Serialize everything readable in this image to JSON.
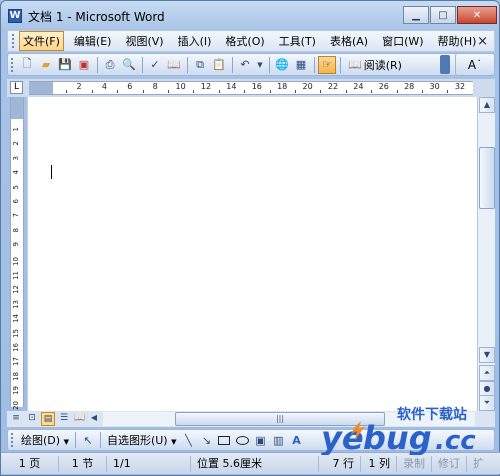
{
  "window": {
    "title": "文档 1 - Microsoft Word",
    "app_icon": "W",
    "minimize_icon": "minimize-icon",
    "maximize_icon": "maximize-icon",
    "close_icon": "close-icon"
  },
  "menu": {
    "items": [
      {
        "label": "文件(F)",
        "active": true
      },
      {
        "label": "编辑(E)"
      },
      {
        "label": "视图(V)"
      },
      {
        "label": "插入(I)"
      },
      {
        "label": "格式(O)"
      },
      {
        "label": "工具(T)"
      },
      {
        "label": "表格(A)"
      },
      {
        "label": "窗口(W)"
      },
      {
        "label": "帮助(H)"
      }
    ],
    "close_glyph": "×"
  },
  "toolbar": {
    "reading_label": "阅读(R)",
    "font_size_glyph": "A˙"
  },
  "ruler": {
    "corner": "L",
    "h_ticks": [
      "2",
      "4",
      "6",
      "8",
      "10",
      "12",
      "14",
      "16",
      "18",
      "20",
      "22",
      "24",
      "26",
      "28",
      "30",
      "32"
    ],
    "v_ticks": [
      "1",
      "2",
      "3",
      "4",
      "5",
      "6",
      "7",
      "8",
      "9",
      "10",
      "11",
      "12",
      "13",
      "14",
      "15",
      "16",
      "17",
      "18",
      "19",
      "20",
      "21"
    ]
  },
  "drawing": {
    "draw_label": "绘图(D)",
    "autoshapes_label": "自选图形(U)"
  },
  "status": {
    "page": "1 页",
    "section": "1 节",
    "page_of": "1/1",
    "position": "位置 5.6厘米",
    "line": "7 行",
    "column": "1 列",
    "record": "录制",
    "revise": "修订",
    "extend": "扩"
  },
  "watermark": {
    "site_cn": "软件下载站",
    "site_en": "yebug.cc"
  },
  "colors": {
    "frame": "#a7c3e6",
    "menu_active": "#ffd489",
    "logo_blue": "#2a62c9",
    "logo_orange": "#f08a1c"
  }
}
